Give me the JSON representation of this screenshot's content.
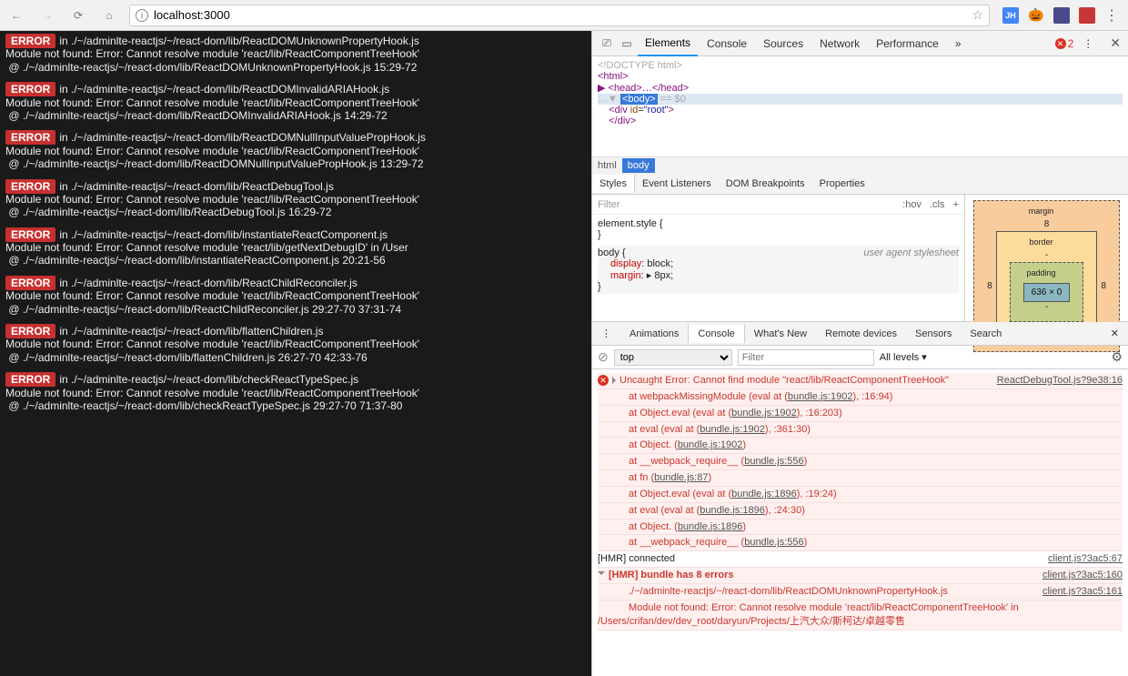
{
  "toolbar": {
    "url": "localhost:3000",
    "extensions": [
      "JH",
      "🎃",
      "◉",
      "☰"
    ]
  },
  "errors": [
    {
      "loc": "in ./~/adminlte-reactjs/~/react-dom/lib/ReactDOMUnknownPropertyHook.js",
      "msg": "Module not found: Error: Cannot resolve module 'react/lib/ReactComponentTreeHook'",
      "at": " @ ./~/adminlte-reactjs/~/react-dom/lib/ReactDOMUnknownPropertyHook.js 15:29-72"
    },
    {
      "loc": "in ./~/adminlte-reactjs/~/react-dom/lib/ReactDOMInvalidARIAHook.js",
      "msg": "Module not found: Error: Cannot resolve module 'react/lib/ReactComponentTreeHook'",
      "at": " @ ./~/adminlte-reactjs/~/react-dom/lib/ReactDOMInvalidARIAHook.js 14:29-72"
    },
    {
      "loc": "in ./~/adminlte-reactjs/~/react-dom/lib/ReactDOMNullInputValuePropHook.js",
      "msg": "Module not found: Error: Cannot resolve module 'react/lib/ReactComponentTreeHook'",
      "at": " @ ./~/adminlte-reactjs/~/react-dom/lib/ReactDOMNullInputValuePropHook.js 13:29-72"
    },
    {
      "loc": "in ./~/adminlte-reactjs/~/react-dom/lib/ReactDebugTool.js",
      "msg": "Module not found: Error: Cannot resolve module 'react/lib/ReactComponentTreeHook'",
      "at": " @ ./~/adminlte-reactjs/~/react-dom/lib/ReactDebugTool.js 16:29-72"
    },
    {
      "loc": "in ./~/adminlte-reactjs/~/react-dom/lib/instantiateReactComponent.js",
      "msg": "Module not found: Error: Cannot resolve module 'react/lib/getNextDebugID' in /User",
      "at": " @ ./~/adminlte-reactjs/~/react-dom/lib/instantiateReactComponent.js 20:21-56"
    },
    {
      "loc": "in ./~/adminlte-reactjs/~/react-dom/lib/ReactChildReconciler.js",
      "msg": "Module not found: Error: Cannot resolve module 'react/lib/ReactComponentTreeHook'",
      "at": " @ ./~/adminlte-reactjs/~/react-dom/lib/ReactChildReconciler.js 29:27-70 37:31-74"
    },
    {
      "loc": "in ./~/adminlte-reactjs/~/react-dom/lib/flattenChildren.js",
      "msg": "Module not found: Error: Cannot resolve module 'react/lib/ReactComponentTreeHook'",
      "at": " @ ./~/adminlte-reactjs/~/react-dom/lib/flattenChildren.js 26:27-70 42:33-76"
    },
    {
      "loc": "in ./~/adminlte-reactjs/~/react-dom/lib/checkReactTypeSpec.js",
      "msg": "Module not found: Error: Cannot resolve module 'react/lib/ReactComponentTreeHook'",
      "at": " @ ./~/adminlte-reactjs/~/react-dom/lib/checkReactTypeSpec.js 29:27-70 71:37-80"
    }
  ],
  "devtools": {
    "tabs": [
      "Elements",
      "Console",
      "Sources",
      "Network",
      "Performance"
    ],
    "active_tab": "Elements",
    "error_count": "2",
    "more_icon": "»",
    "dom": {
      "l0": "<!DOCTYPE html>",
      "l1": "<html>",
      "l2": "▶ <head>…</head>",
      "l3_pre": "…▼ ",
      "l3_body": "<body>",
      "l3_post": " == $0",
      "l4": "    <div id=\"root\">",
      "l5": "    </div>"
    },
    "crumbs": [
      "html",
      "body"
    ],
    "styles_tabs": [
      "Styles",
      "Event Listeners",
      "DOM Breakpoints",
      "Properties"
    ],
    "filter_placeholder": "Filter",
    "hov": ":hov",
    "cls": ".cls",
    "css_element": "element.style {",
    "css_body": "body {",
    "css_ua": "user agent stylesheet",
    "css_display": "display: block;",
    "css_margin": "margin: ▸ 8px;",
    "box": {
      "margin": "margin",
      "border": "border",
      "padding": "padding",
      "content": "636 × 0",
      "top": "8",
      "side": "8",
      "dash": "-"
    }
  },
  "drawer": {
    "tabs": [
      "Animations",
      "Console",
      "What's New",
      "Remote devices",
      "Sensors",
      "Search"
    ],
    "active": "Console",
    "context": "top",
    "filter_placeholder": "Filter",
    "levels": "All levels ▾",
    "lines": [
      {
        "t": "err_head",
        "src": "ReactDebugTool.js?9e38:16",
        "text": "Uncaught Error: Cannot find module \"react/lib/ReactComponentTreeHook\""
      },
      {
        "t": "stack",
        "text": "    at webpackMissingModule (eval at <anonymous> (bundle.js:1902), <anonymous>:16:94)"
      },
      {
        "t": "stack",
        "text": "    at Object.eval (eval at <anonymous> (bundle.js:1902), <anonymous>:16:203)"
      },
      {
        "t": "stack",
        "text": "    at eval (eval at <anonymous> (bundle.js:1902), <anonymous>:361:30)"
      },
      {
        "t": "stack",
        "text": "    at Object.<anonymous> (bundle.js:1902)"
      },
      {
        "t": "stack",
        "text": "    at __webpack_require__ (bundle.js:556)"
      },
      {
        "t": "stack",
        "text": "    at fn (bundle.js:87)"
      },
      {
        "t": "stack",
        "text": "    at Object.eval (eval at <anonymous> (bundle.js:1896), <anonymous>:19:24)"
      },
      {
        "t": "stack",
        "text": "    at eval (eval at <anonymous> (bundle.js:1896), <anonymous>:24:30)"
      },
      {
        "t": "stack",
        "text": "    at Object.<anonymous> (bundle.js:1896)"
      },
      {
        "t": "stack",
        "text": "    at __webpack_require__ (bundle.js:556)"
      },
      {
        "t": "log",
        "src": "client.js?3ac5:67",
        "text": "[HMR] connected"
      },
      {
        "t": "err_bold",
        "src": "client.js?3ac5:160",
        "text": "[HMR] bundle has 8 errors"
      },
      {
        "t": "stack",
        "src": "client.js?3ac5:161",
        "text": "./~/adminlte-reactjs/~/react-dom/lib/ReactDOMUnknownPropertyHook.js"
      },
      {
        "t": "stack",
        "text": "Module not found: Error: Cannot resolve module 'react/lib/ReactComponentTreeHook' in /Users/crifan/dev/dev_root/daryun/Projects/上汽大众/斯柯达/卓越零售"
      }
    ]
  },
  "labels": {
    "error": "ERROR"
  }
}
